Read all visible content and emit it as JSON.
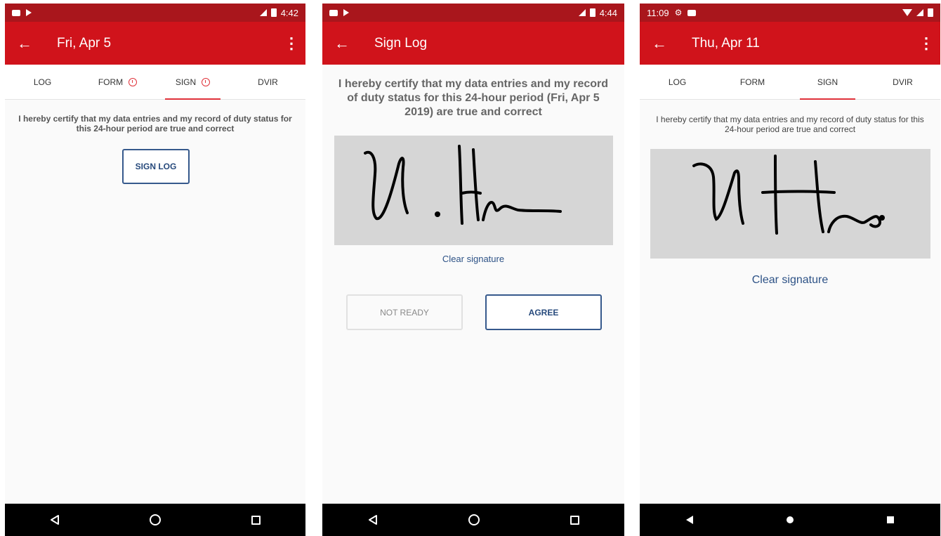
{
  "screens": [
    {
      "status": {
        "time": "4:42"
      },
      "title": "Fri, Apr 5",
      "tabs": [
        {
          "label": "LOG",
          "alert": false
        },
        {
          "label": "FORM",
          "alert": true
        },
        {
          "label": "SIGN",
          "alert": true,
          "active": true
        },
        {
          "label": "DVIR",
          "alert": false
        }
      ],
      "certify_text": "I hereby certify that my data entries and my record of duty status for this 24-hour period are true and correct",
      "sign_log_label": "SIGN LOG"
    },
    {
      "status": {
        "time": "4:44"
      },
      "title": "Sign Log",
      "certify_text": "I hereby certify that my data entries and my record of duty status for this 24-hour period (Fri, Apr 5 2019) are true and correct",
      "clear_signature_label": "Clear signature",
      "not_ready_label": "NOT READY",
      "agree_label": "AGREE"
    },
    {
      "status": {
        "time": "11:09"
      },
      "title": "Thu, Apr 11",
      "tabs": [
        {
          "label": "LOG"
        },
        {
          "label": "FORM"
        },
        {
          "label": "SIGN",
          "active": true
        },
        {
          "label": "DVIR"
        }
      ],
      "certify_text": "I hereby certify that my data entries and my record of duty status for this 24-hour period are true and correct",
      "clear_signature_label": "Clear signature"
    }
  ],
  "colors": {
    "appbar": "#d0131b",
    "statusbar": "#a9161c",
    "accent": "#e0323a",
    "link": "#2d5286"
  }
}
